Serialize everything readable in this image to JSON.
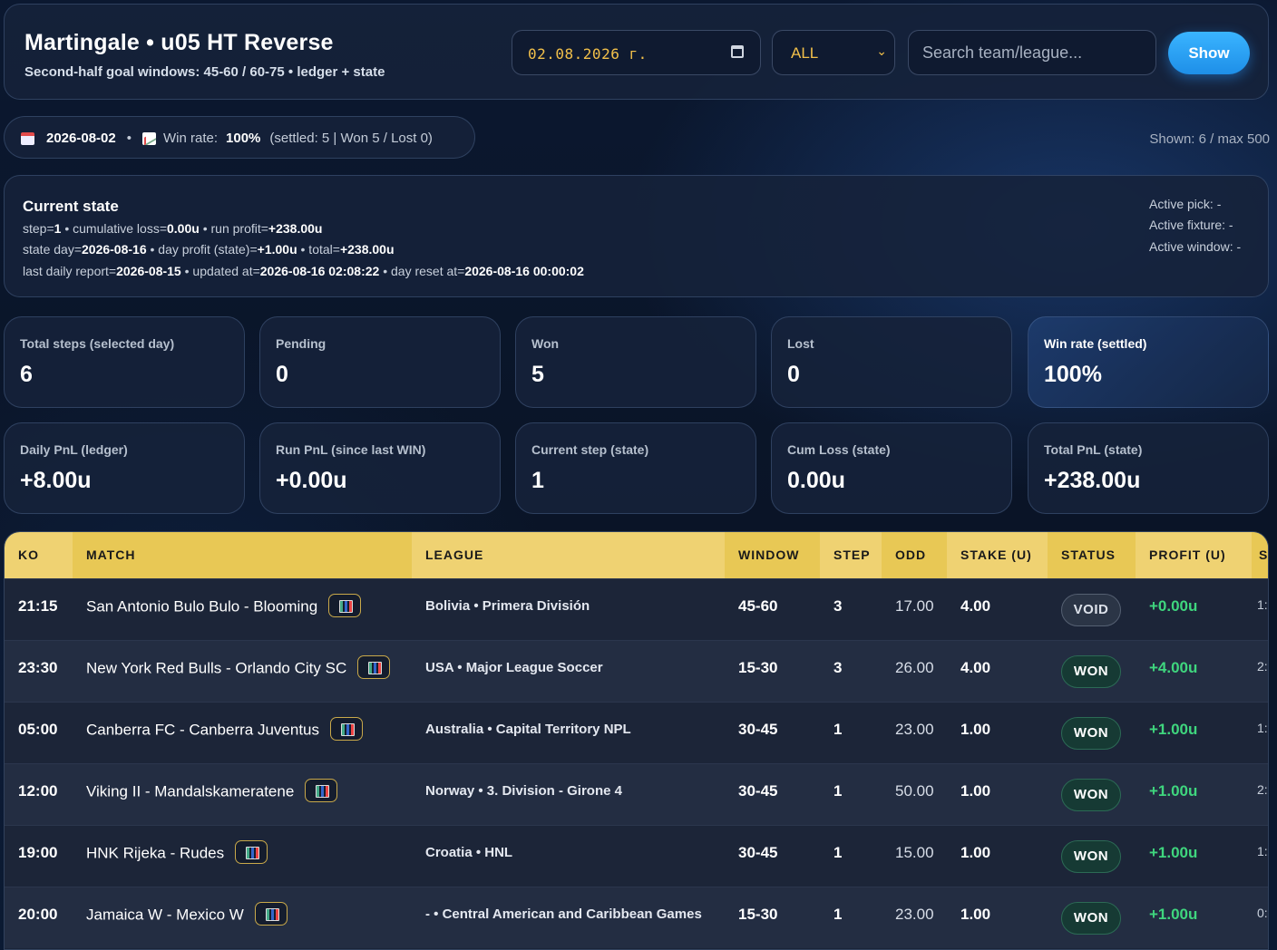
{
  "header": {
    "title": "Martingale • u05 HT Reverse",
    "subtitle": "Second-half goal windows: 45-60 / 60-75 • ledger + state",
    "date_value": "02.08.2026 г.",
    "filter_value": "ALL",
    "search_placeholder": "Search team/league...",
    "show_label": "Show"
  },
  "summary": {
    "date": "2026-08-02",
    "winrate_label": "Win rate:",
    "winrate_value": "100%",
    "settled_text": "(settled: 5 | Won 5 / Lost 0)",
    "shown": "Shown: 6 / max 500"
  },
  "state": {
    "title": "Current state",
    "line1": [
      {
        "t": "step="
      },
      {
        "b": "1"
      },
      {
        "t": " • cumulative loss="
      },
      {
        "b": "0.00u"
      },
      {
        "t": " • run profit="
      },
      {
        "b": "+238.00u"
      }
    ],
    "line2": [
      {
        "t": "state day="
      },
      {
        "b": "2026-08-16"
      },
      {
        "t": " • day profit (state)="
      },
      {
        "b": "+1.00u"
      },
      {
        "t": " • total="
      },
      {
        "b": "+238.00u"
      }
    ],
    "line3": [
      {
        "t": "last daily report="
      },
      {
        "b": "2026-08-15"
      },
      {
        "t": " • updated at="
      },
      {
        "b": "2026-08-16 02:08:22"
      },
      {
        "t": " • day reset at="
      },
      {
        "b": "2026-08-16 00:00:02"
      }
    ],
    "active_pick": "Active pick: -",
    "active_fixture": "Active fixture: -",
    "active_window": "Active window: -"
  },
  "stats_row1": [
    {
      "label": "Total steps (selected day)",
      "value": "6"
    },
    {
      "label": "Pending",
      "value": "0"
    },
    {
      "label": "Won",
      "value": "5"
    },
    {
      "label": "Lost",
      "value": "0"
    },
    {
      "label": "Win rate (settled)",
      "value": "100%"
    }
  ],
  "stats_row2": [
    {
      "label": "Daily PnL (ledger)",
      "value": "+8.00u"
    },
    {
      "label": "Run PnL (since last WIN)",
      "value": "+0.00u"
    },
    {
      "label": "Current step (state)",
      "value": "1"
    },
    {
      "label": "Cum Loss (state)",
      "value": "0.00u"
    },
    {
      "label": "Total PnL (state)",
      "value": "+238.00u"
    }
  ],
  "table": {
    "columns": [
      "KO",
      "MATCH",
      "LEAGUE",
      "WINDOW",
      "STEP",
      "ODD",
      "STAKE (U)",
      "STATUS",
      "PROFIT (U)",
      "SC"
    ],
    "rows": [
      {
        "ko": "21:15",
        "match": "San Antonio Bulo Bulo - Blooming",
        "league": "Bolivia • Primera División",
        "window": "45-60",
        "step": "3",
        "odd": "17.00",
        "stake": "4.00",
        "status": "VOID",
        "profit": "+0.00u",
        "score": "1:"
      },
      {
        "ko": "23:30",
        "match": "New York Red Bulls - Orlando City SC",
        "league": "USA • Major League Soccer",
        "window": "15-30",
        "step": "3",
        "odd": "26.00",
        "stake": "4.00",
        "status": "WON",
        "profit": "+4.00u",
        "score": "2:"
      },
      {
        "ko": "05:00",
        "match": "Canberra FC - Canberra Juventus",
        "league": "Australia • Capital Territory NPL",
        "window": "30-45",
        "step": "1",
        "odd": "23.00",
        "stake": "1.00",
        "status": "WON",
        "profit": "+1.00u",
        "score": "1:"
      },
      {
        "ko": "12:00",
        "match": "Viking II - Mandalskameratene",
        "league": "Norway • 3. Division - Girone 4",
        "window": "30-45",
        "step": "1",
        "odd": "50.00",
        "stake": "1.00",
        "status": "WON",
        "profit": "+1.00u",
        "score": "2:"
      },
      {
        "ko": "19:00",
        "match": "HNK Rijeka - Rudes",
        "league": "Croatia • HNL",
        "window": "30-45",
        "step": "1",
        "odd": "15.00",
        "stake": "1.00",
        "status": "WON",
        "profit": "+1.00u",
        "score": "1:"
      },
      {
        "ko": "20:00",
        "match": "Jamaica W - Mexico W",
        "league": "- • Central American and Caribbean Games",
        "window": "15-30",
        "step": "1",
        "odd": "23.00",
        "stake": "1.00",
        "status": "WON",
        "profit": "+1.00u",
        "score": "0:"
      }
    ]
  }
}
